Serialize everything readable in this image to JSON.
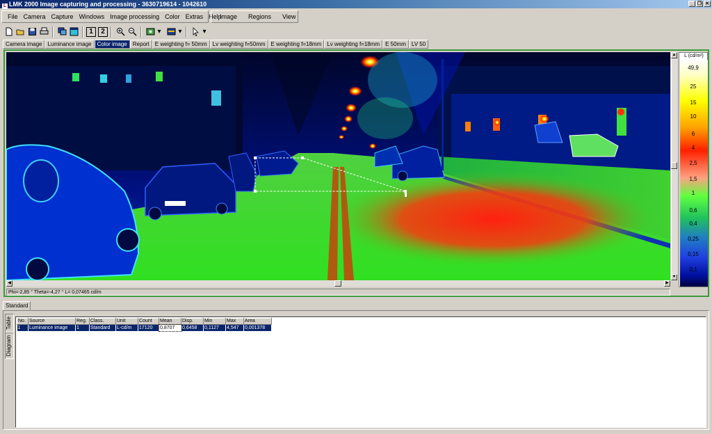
{
  "window": {
    "title": "LMK 2000 Image capturing and processing - 3630719614 - 1042610"
  },
  "menu": {
    "main": [
      "File",
      "Camera",
      "Capture",
      "Windows",
      "Image processing",
      "Color",
      "Extras",
      "Help"
    ],
    "secondary": [
      "Image",
      "Regions",
      "View"
    ]
  },
  "tabs": [
    "Camera image",
    "Luminance image",
    "Color image",
    "Report",
    "E weighting f= 50mm",
    "Lv weighting f=50mm",
    "E weighting f=18mm",
    "Lv weighting f=18mm",
    "E 50mm",
    "LV 50"
  ],
  "active_tab": "Color image",
  "legend": {
    "title": "L (cd/m²)",
    "labels": [
      "49,9",
      "25",
      "15",
      "10",
      "6",
      "4",
      "2,5",
      "1,5",
      "1",
      "0,6",
      "0,4",
      "0,25",
      "0,15",
      "0,1"
    ]
  },
  "statusline": "Phi=-2,85 °  Theta=-4,27 °  L= 0,07465  cd/m",
  "lower": {
    "tab": "Standard",
    "vtabs": [
      "Table",
      "Diagram"
    ],
    "table": {
      "headers": [
        "No.",
        "Source",
        "Reg.",
        "Class.",
        "Unit",
        "Count",
        "Mean",
        "Disp.",
        "Min",
        "Max",
        "Area"
      ],
      "rows": [
        [
          "1",
          "Luminance image",
          "1",
          "Standard",
          "L-cd/m",
          "17120",
          "0,8707",
          "0,6458",
          "0,1127",
          "4,547",
          "0,001378"
        ]
      ]
    }
  }
}
